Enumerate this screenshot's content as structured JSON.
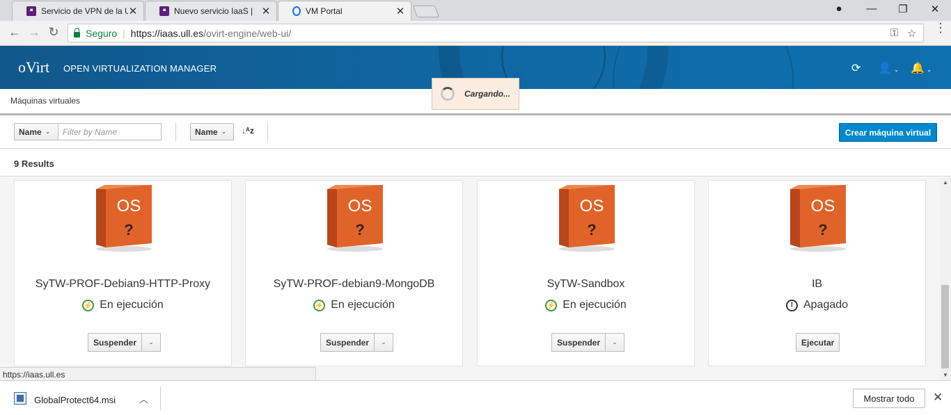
{
  "browser": {
    "tabs": [
      {
        "title": "Servicio de VPN de la ULL",
        "favicon_color": "#5c1f7a",
        "active": false
      },
      {
        "title": "Nuevo servicio IaaS |",
        "favicon_color": "#5c1f7a",
        "active": false
      },
      {
        "title": "VM Portal",
        "favicon_color": "#1a73e8",
        "active": true
      }
    ],
    "secure_label": "Seguro",
    "url_host": "https://iaas.ull.es",
    "url_path": "/ovirt-engine/web-ui/",
    "status_url": "https://iaas.ull.es"
  },
  "header": {
    "logo": "oVirt",
    "title": "OPEN VIRTUALIZATION MANAGER"
  },
  "breadcrumb": "Máquinas virtuales",
  "loading_text": "Cargando...",
  "toolbar": {
    "filter_field": "Name",
    "filter_placeholder": "Filter by Name",
    "sort_field": "Name",
    "create_label": "Crear máquina virtual"
  },
  "results_label": "9 Results",
  "vms": [
    {
      "name": "SyTW-PROF-Debian9-HTTP-Proxy",
      "status": "En ejecución",
      "running": true,
      "action": "Suspender"
    },
    {
      "name": "SyTW-PROF-debian9-MongoDB",
      "status": "En ejecución",
      "running": true,
      "action": "Suspender"
    },
    {
      "name": "SyTW-Sandbox",
      "status": "En ejecución",
      "running": true,
      "action": "Suspender"
    },
    {
      "name": "IB",
      "status": "Apagado",
      "running": false,
      "action": "Ejecutar"
    }
  ],
  "os_box_label": "OS",
  "os_box_mark": "?",
  "download": {
    "file": "GlobalProtect64.msi",
    "show_all": "Mostrar todo"
  },
  "colors": {
    "header_blue": "#0f6aa6",
    "create_button": "#0088ce",
    "running_green": "#3f9c35",
    "os_box_orange": "#e0642a"
  }
}
